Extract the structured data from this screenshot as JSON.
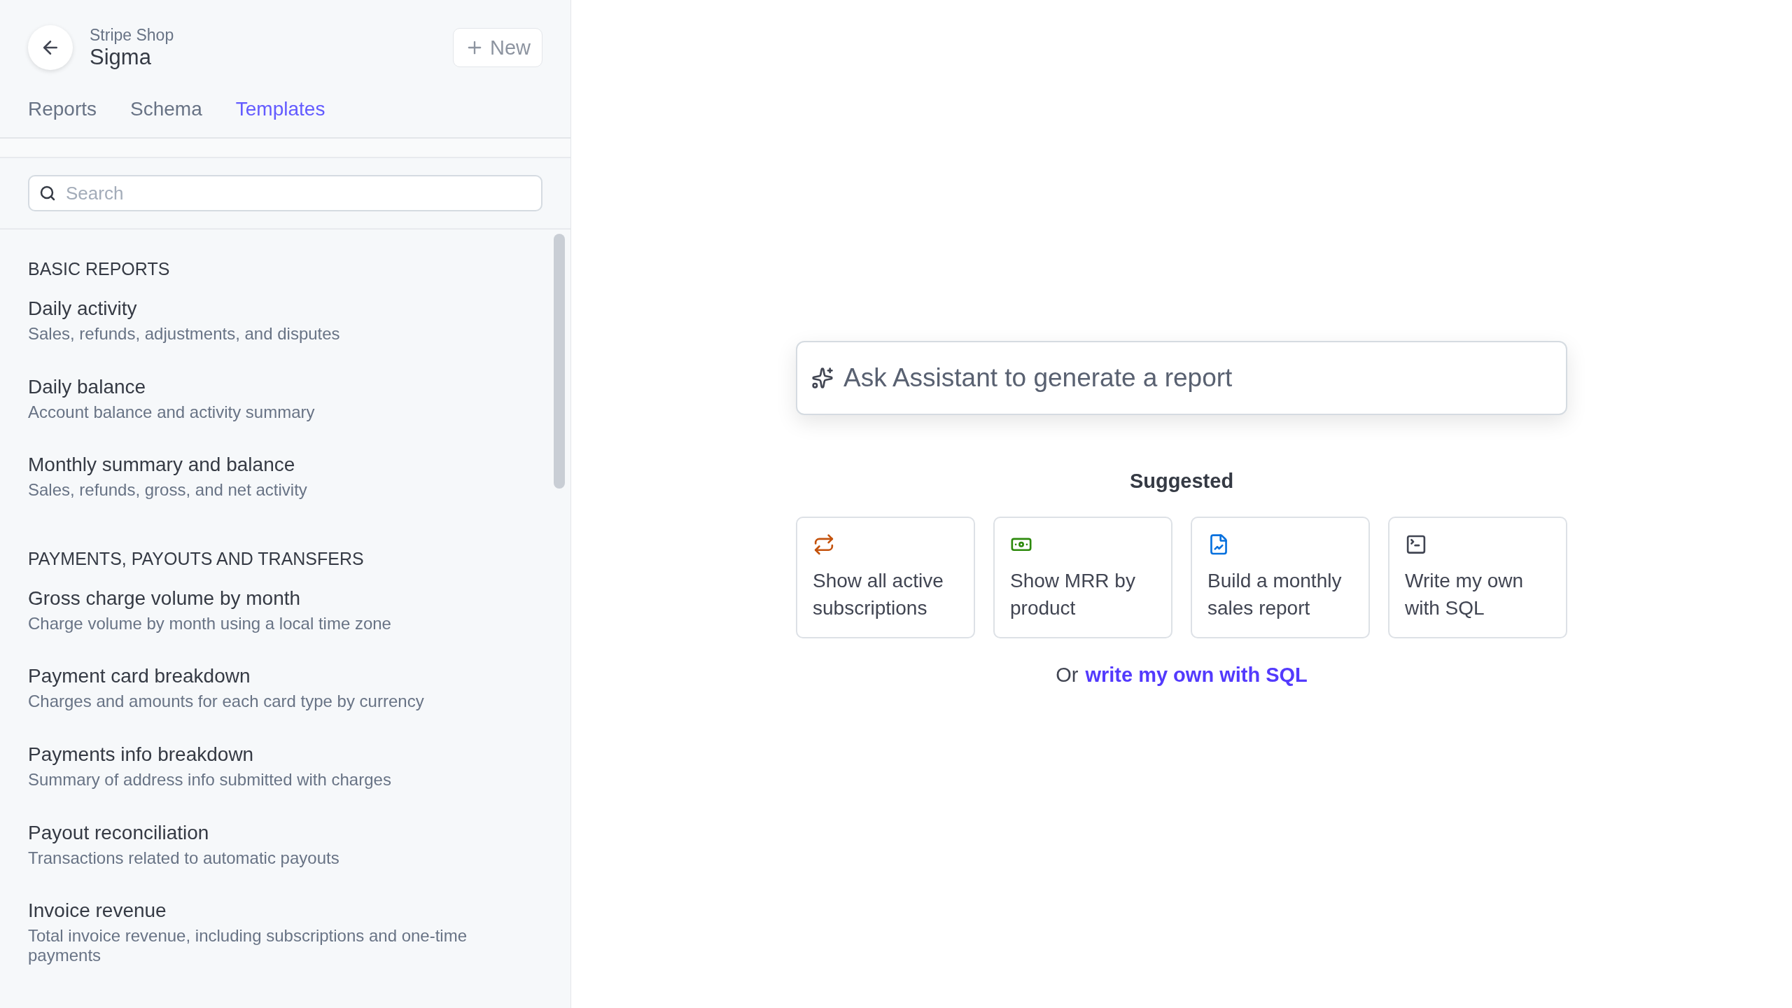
{
  "header": {
    "account": "Stripe Shop",
    "app": "Sigma",
    "new_button": "New"
  },
  "tabs": [
    {
      "label": "Reports",
      "selected": false
    },
    {
      "label": "Schema",
      "selected": false
    },
    {
      "label": "Templates",
      "selected": true
    }
  ],
  "search": {
    "placeholder": "Search"
  },
  "sections": [
    {
      "title": "BASIC REPORTS",
      "items": [
        {
          "title": "Daily activity",
          "description": "Sales, refunds, adjustments, and disputes"
        },
        {
          "title": "Daily balance",
          "description": "Account balance and activity summary"
        },
        {
          "title": "Monthly summary and balance",
          "description": "Sales, refunds, gross, and net activity"
        }
      ]
    },
    {
      "title": "PAYMENTS, PAYOUTS AND TRANSFERS",
      "items": [
        {
          "title": "Gross charge volume by month",
          "description": "Charge volume by month using a local time zone"
        },
        {
          "title": "Payment card breakdown",
          "description": "Charges and amounts for each card type by currency"
        },
        {
          "title": "Payments info breakdown",
          "description": "Summary of address info submitted with charges"
        },
        {
          "title": "Payout reconciliation",
          "description": "Transactions related to automatic payouts"
        },
        {
          "title": "Invoice revenue",
          "description": "Total invoice revenue, including subscriptions and one-time payments"
        }
      ]
    }
  ],
  "assistant": {
    "placeholder": "Ask Assistant to generate a report"
  },
  "suggested": {
    "title": "Suggested",
    "cards": [
      {
        "kind": "repeat",
        "label": "Show all active subscriptions"
      },
      {
        "kind": "money",
        "label": "Show MRR by product"
      },
      {
        "kind": "chart",
        "label": "Build a monthly sales report"
      },
      {
        "kind": "terminal",
        "label": "Write my own with SQL"
      }
    ]
  },
  "footer": {
    "prefix": "Or",
    "link": "write my own with SQL"
  }
}
